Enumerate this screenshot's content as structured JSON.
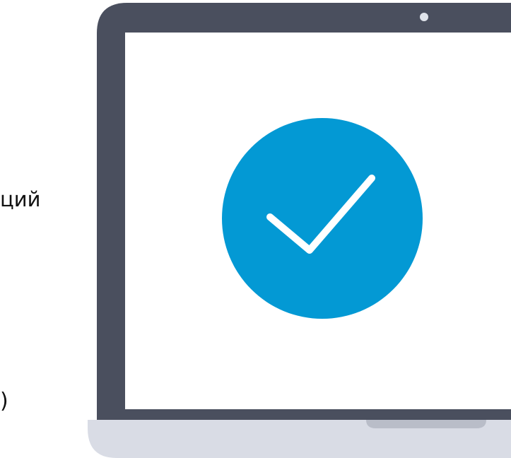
{
  "visible_text": {
    "left_fragment_top": "ций",
    "left_fragment_bottom": ")"
  },
  "laptop": {
    "status": "success",
    "icon": "check-circle-icon",
    "colors": {
      "frame": "#4a4f5e",
      "screen": "#ffffff",
      "base": "#d9dce5",
      "base_shadow": "#b9bdc8",
      "camera": "#dfe3ea",
      "success_circle": "#0399d4",
      "checkmark": "#ffffff",
      "text": "#111111"
    }
  }
}
